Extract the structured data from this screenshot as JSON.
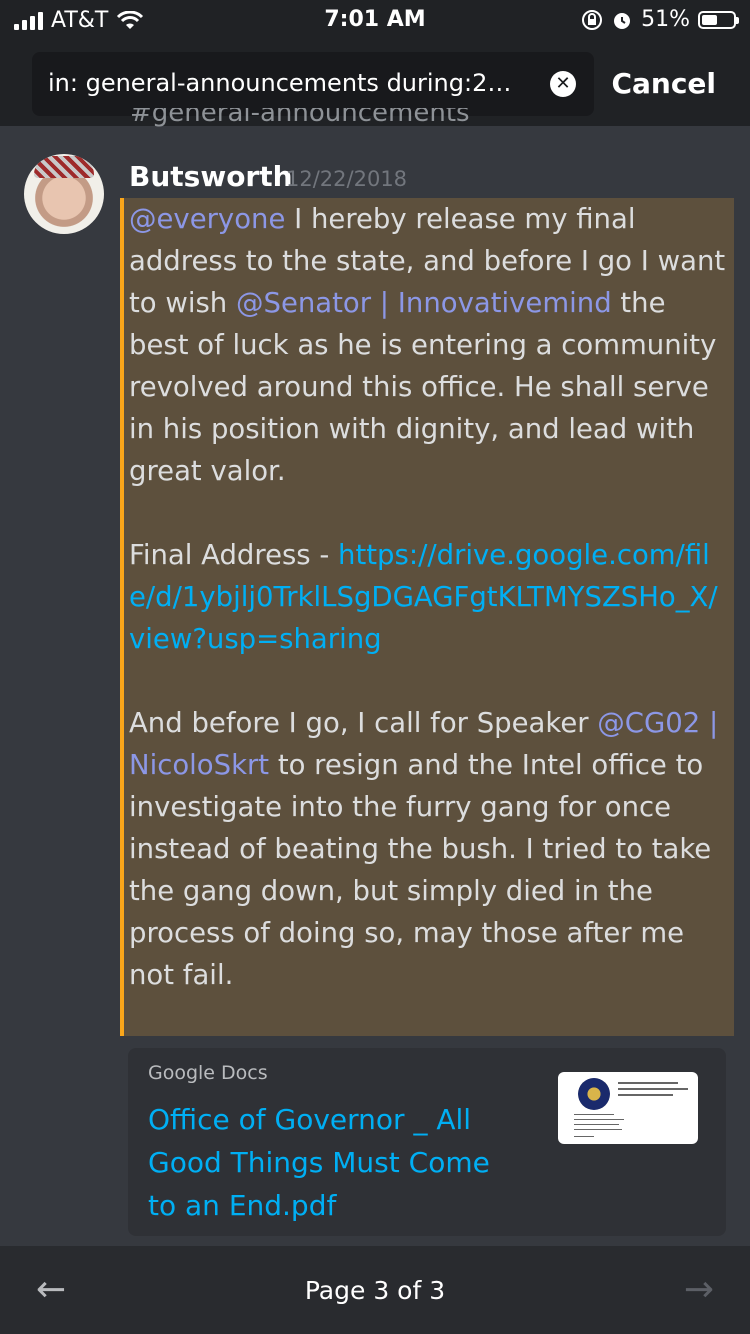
{
  "status_bar": {
    "carrier": "AT&T",
    "time": "7:01 AM",
    "battery_percent": "51%",
    "battery_level": 0.51
  },
  "search": {
    "query": "in: general-announcements during:201...",
    "cancel_label": "Cancel"
  },
  "channel_peek": "#general-announcements",
  "message": {
    "author": "Butsworth",
    "timestamp": "12/22/2018",
    "p1_mention1": "@everyone",
    "p1_text1": " I hereby release my final address to the state, and before I go I want to wish ",
    "p1_mention2": "@Senator | Innovativemind",
    "p1_text2": " the best of luck as he is entering a community revolved around this office. He shall serve in his position with dignity, and lead with great valor.",
    "p2_text": "Final Address - ",
    "p2_link": "https://drive.google.com/file/d/1ybjlj0TrklLSgDGAGFgtKLTMYSZSHo_X/view?usp=sharing",
    "p3_text1": "And before I go, I call for Speaker ",
    "p3_mention": "@CG02 | NicoloSkrt",
    "p3_text2": " to resign and the Intel office to investigate into the furry gang for once instead of beating the bush. I tried to take the gang down, but simply died in the process of doing so, may those after me not fail."
  },
  "embed": {
    "provider": "Google Docs",
    "title": "Office of Governor _ All Good Things Must Come to an End.pdf"
  },
  "footer": {
    "page_label": "Page 3 of 3",
    "prev_icon": "arrow-left-icon",
    "next_icon": "arrow-right-icon"
  },
  "colors": {
    "background": "#36393f",
    "header": "#202225",
    "mention": "#8c97e6",
    "link": "#00aff4",
    "highlight": "#5d503d",
    "highlight_border": "#faa61a"
  }
}
